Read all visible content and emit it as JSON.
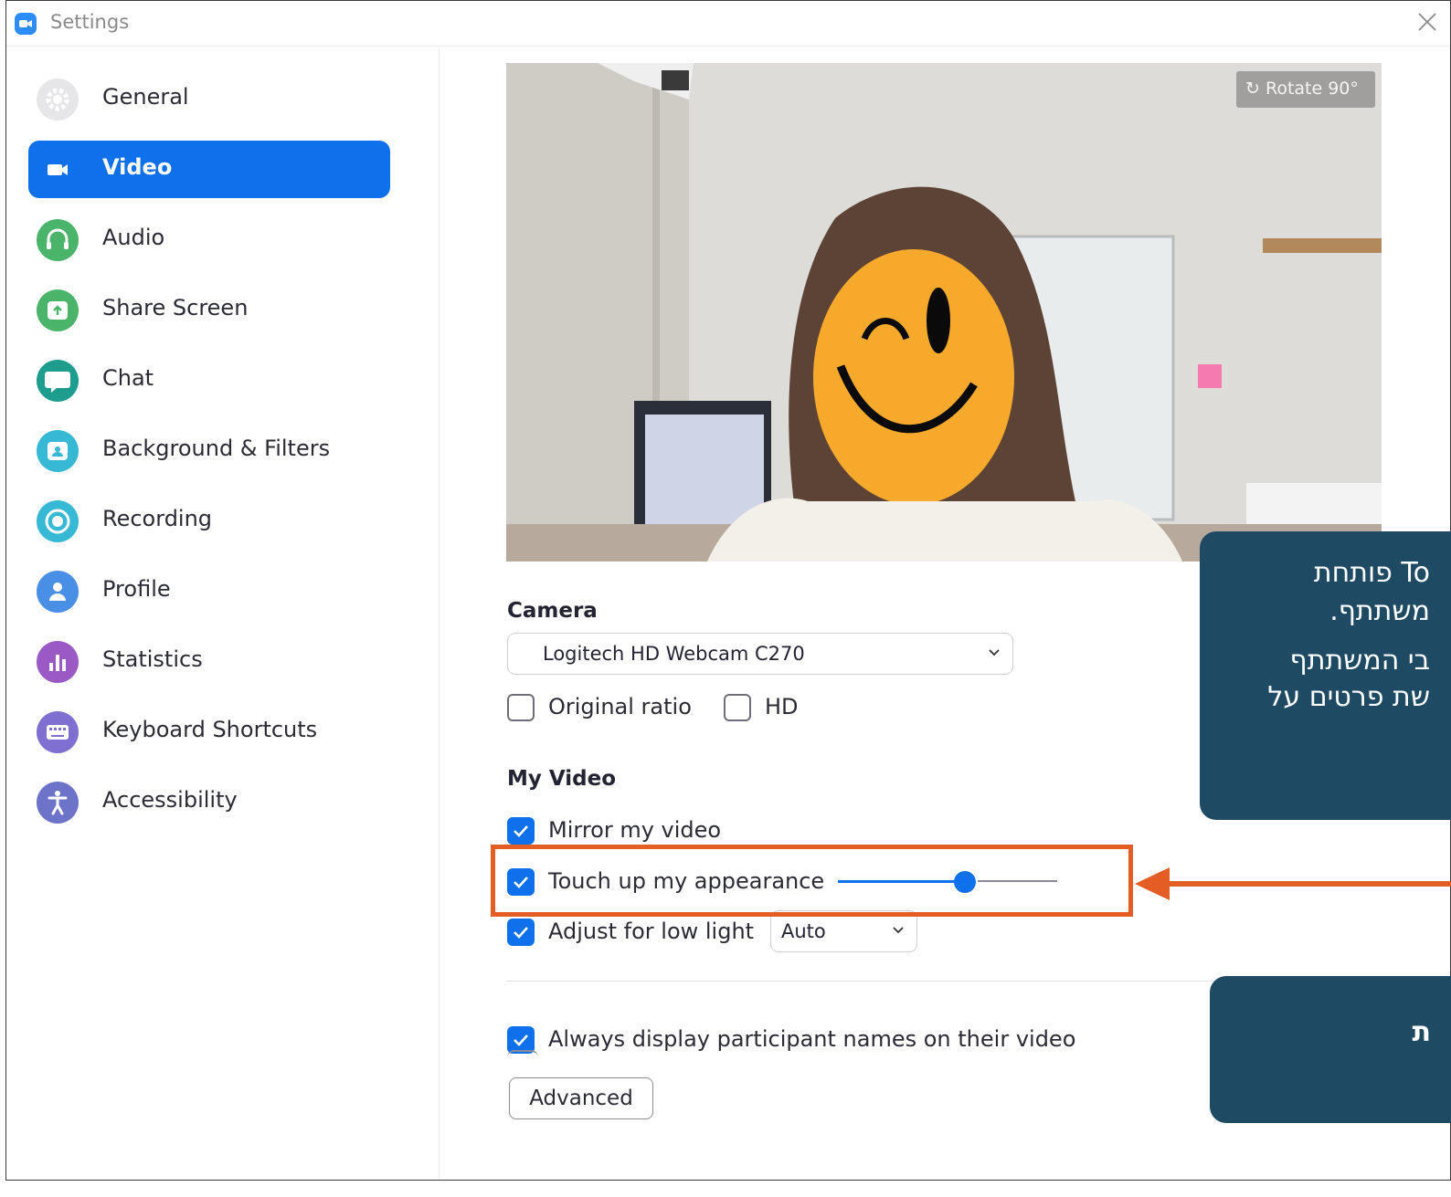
{
  "window": {
    "title": "Settings"
  },
  "sidebar": {
    "items": [
      {
        "label": "General",
        "icon": "gear-icon",
        "color": "#e8e8ea"
      },
      {
        "label": "Video",
        "icon": "video-camera-icon",
        "color": "#0e71eb",
        "active": true
      },
      {
        "label": "Audio",
        "icon": "headphones-icon",
        "color": "#4ab56a"
      },
      {
        "label": "Share Screen",
        "icon": "share-screen-icon",
        "color": "#4ab56a"
      },
      {
        "label": "Chat",
        "icon": "chat-bubble-icon",
        "color": "#1e9c8e"
      },
      {
        "label": "Background & Filters",
        "icon": "background-icon",
        "color": "#37b9d5"
      },
      {
        "label": "Recording",
        "icon": "recording-icon",
        "color": "#37b9d5"
      },
      {
        "label": "Profile",
        "icon": "profile-icon",
        "color": "#4a8fe6"
      },
      {
        "label": "Statistics",
        "icon": "statistics-icon",
        "color": "#9b59c6"
      },
      {
        "label": "Keyboard Shortcuts",
        "icon": "keyboard-icon",
        "color": "#7e6fd1"
      },
      {
        "label": "Accessibility",
        "icon": "accessibility-icon",
        "color": "#6c73c9"
      }
    ]
  },
  "preview": {
    "rotate_label": "Rotate 90°"
  },
  "camera": {
    "title": "Camera",
    "selected": "Logitech HD Webcam C270",
    "original_ratio": {
      "label": "Original ratio",
      "checked": false
    },
    "hd": {
      "label": "HD",
      "checked": false
    }
  },
  "my_video": {
    "title": "My Video",
    "mirror": {
      "label": "Mirror my video",
      "checked": true
    },
    "touch_up": {
      "label": "Touch up my appearance",
      "checked": true,
      "level": 0.58
    },
    "low_light": {
      "label": "Adjust for low light",
      "checked": true,
      "mode": "Auto"
    }
  },
  "always_names": {
    "label": "Always display participant names on their video",
    "checked": true
  },
  "advanced_label": "Advanced",
  "callouts": {
    "first": {
      "line1": "To פותחת",
      "line2": "משתתף.",
      "line3": "בי המשתתף",
      "line4": "שת פרטים על"
    },
    "second": {
      "line1": "ת"
    }
  },
  "colors": {
    "accent": "#0e71eb",
    "highlight": "#e35d24",
    "callout": "#1e4a63"
  }
}
